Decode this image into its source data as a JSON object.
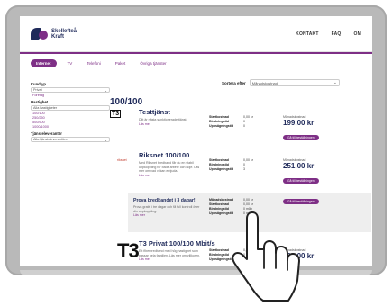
{
  "header": {
    "logo_line1": "Skellefteå",
    "logo_line2": "Kraft",
    "nav": [
      "KONTAKT",
      "FAQ",
      "OM"
    ]
  },
  "tabs": [
    "Internet",
    "TV",
    "Telefoni",
    "Paket",
    "Övriga tjänster"
  ],
  "sidebar": {
    "group1_label": "Kundtyp",
    "group1_select": "Privat",
    "group1_option": "Företag",
    "group2_label": "Hastighet",
    "group2_select": "Alla hastigheter",
    "group2_options": [
      "100/100",
      "250/250",
      "500/500",
      "1000/1000"
    ],
    "group3_label": "Tjänsteleverantör",
    "group3_select": "Alla tjänsteleverantörer"
  },
  "sort": {
    "label": "Sortera efter",
    "value": "Månadskostnad"
  },
  "speed_heading": "100/100",
  "cards": [
    {
      "logo": "T3",
      "title": "Testtjänst",
      "desc": "Ditt är nästa sanktionerade tjänst.",
      "link": "Läs mer",
      "specs": [
        {
          "k": "Startkostnad",
          "v": "0,00 kr"
        },
        {
          "k": "Bindningstid",
          "v": "0"
        },
        {
          "k": "Uppsägningstid",
          "v": "0"
        }
      ],
      "price_label": "Månadskostnad",
      "price": "199,00 kr",
      "button": "Gå till beställningen"
    },
    {
      "badge": "riksnet",
      "title": "Riksnet 100/100",
      "desc": "Med Riksnet bredband får du en stabil uppkoppling för både arbete och nöje. Läs mer om vad vi kan erbjuda.",
      "link": "Läs mer",
      "specs": [
        {
          "k": "Startkostnad",
          "v": "0,00 kr"
        },
        {
          "k": "Bindningstid",
          "v": "0"
        },
        {
          "k": "Uppsägningstid",
          "v": "3"
        }
      ],
      "price_label": "Månadskostnad",
      "price": "251,00 kr",
      "button": "Gå till beställningen"
    }
  ],
  "promo": {
    "title": "Prova bredbandet i 3 dagar!",
    "desc": "Prova gratis i tre dagar och få full kontroll över din uppkoppling.",
    "link": "Läs mer",
    "specs": [
      {
        "k": "Månadskostnad",
        "v": "0,00 kr"
      },
      {
        "k": "Startkostnad",
        "v": "0,00 kr"
      },
      {
        "k": "Bindningstid",
        "v": "0 mån"
      },
      {
        "k": "Uppsägningstid",
        "v": "0 mån"
      }
    ],
    "button": "Gå till beställningen"
  },
  "card3": {
    "logo": "T3",
    "title": "T3 Privat 100/100 Mbit/s",
    "desc": "Ett fiberbredband med hög hastighet som passar hela familjen. Läs mer om villkoren.",
    "link": "Läs mer",
    "specs": [
      {
        "k": "Startkostnad",
        "v": "0,00 kr"
      },
      {
        "k": "Bindningstid",
        "v": "0"
      },
      {
        "k": "Uppsägningstid",
        "v": "3"
      }
    ],
    "price_label": "Månadskostnad",
    "price": "302,00 kr"
  },
  "colors": {
    "brand_purple": "#7e2f86",
    "brand_navy": "#1f2a5a"
  }
}
